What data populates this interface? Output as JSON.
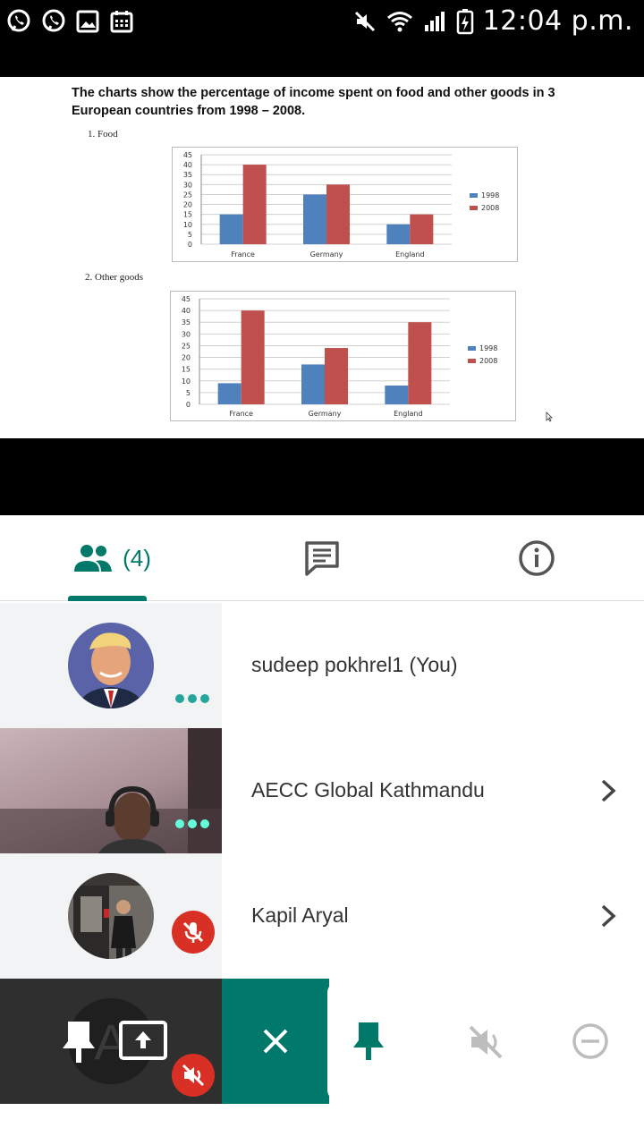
{
  "status_bar": {
    "time": "12:04 p.m.",
    "left_icons": [
      "viber-icon",
      "viber-call-icon",
      "gallery-icon",
      "calendar-icon"
    ],
    "right_icons": [
      "mute-icon",
      "wifi-icon",
      "signal-icon",
      "battery-icon"
    ]
  },
  "slide": {
    "title": "The charts show the percentage of income spent on food and other goods in 3 European countries from 1998 – 2008.",
    "chart1_label": "1.   Food",
    "chart2_label": "2.   Other goods"
  },
  "chart_data": [
    {
      "type": "bar",
      "title": "Food",
      "categories": [
        "France",
        "Germany",
        "England"
      ],
      "series": [
        {
          "name": "1998",
          "values": [
            15,
            25,
            10
          ],
          "color": "#4f81bd"
        },
        {
          "name": "2008",
          "values": [
            40,
            30,
            15
          ],
          "color": "#c0504d"
        }
      ],
      "yticks": [
        "0",
        "5",
        "10",
        "15",
        "20",
        "25",
        "30",
        "35",
        "40",
        "45"
      ],
      "ylim": [
        0,
        45
      ],
      "grid": true,
      "legend_position": "right"
    },
    {
      "type": "bar",
      "title": "Other goods",
      "categories": [
        "France",
        "Germany",
        "England"
      ],
      "series": [
        {
          "name": "1998",
          "values": [
            9,
            17,
            8
          ],
          "color": "#4f81bd"
        },
        {
          "name": "2008",
          "values": [
            40,
            24,
            35
          ],
          "color": "#c0504d"
        }
      ],
      "yticks": [
        "0",
        "5",
        "10",
        "15",
        "20",
        "25",
        "30",
        "35",
        "40",
        "45"
      ],
      "ylim": [
        0,
        45
      ],
      "grid": true,
      "legend_position": "right"
    }
  ],
  "tabs": {
    "people_count": "(4)",
    "accent": "#00796b"
  },
  "participants": [
    {
      "name": "sudeep pokhrel1 (You)",
      "status": "speaking-dots"
    },
    {
      "name": "AECC Global Kathmandu",
      "status": "speaking-dots"
    },
    {
      "name": "Kapil Aryal",
      "status": "muted"
    }
  ],
  "bottom_actions": {
    "self_tile_icons": [
      "pin-icon",
      "present-screen-icon",
      "volume-off-icon"
    ],
    "actions": [
      "close-icon",
      "pin-icon",
      "volume-off-icon",
      "remove-icon"
    ]
  }
}
